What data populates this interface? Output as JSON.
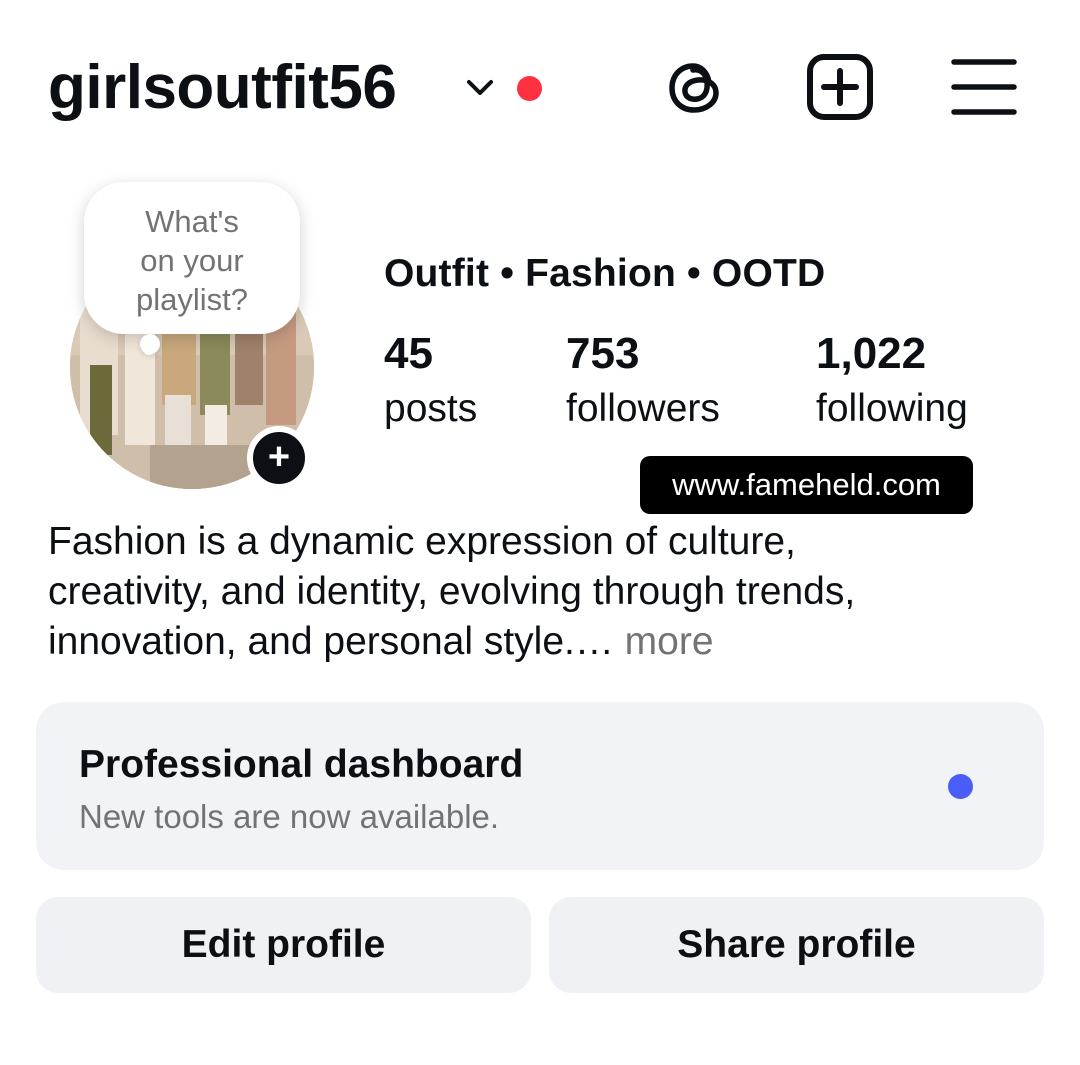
{
  "header": {
    "username": "girlsoutfit56",
    "icons": {
      "chevron": "chevron-down-icon",
      "notification_dot": "red-dot",
      "threads": "threads-icon",
      "create": "add-square-icon",
      "menu": "hamburger-menu-icon"
    },
    "notification_color": "#ff3040"
  },
  "profile": {
    "note_bubble": {
      "line1": "What's",
      "line2": "on your",
      "line3": "playlist?"
    },
    "add_story_label": "+",
    "category": "Outfit • Fashion • OOTD",
    "stats": [
      {
        "value": "45",
        "label": "posts"
      },
      {
        "value": "753",
        "label": "followers"
      },
      {
        "value": "1,022",
        "label": "following"
      }
    ],
    "watermark": "www.fameheld.com",
    "bio": {
      "line1": "Fashion is a dynamic expression of culture,",
      "line2": "creativity, and identity, evolving through trends,",
      "line3": "innovation, and personal style.…",
      "more": " more"
    }
  },
  "dashboard": {
    "title": "Professional dashboard",
    "subtitle": "New tools are now available.",
    "indicator_color": "#4a5df9"
  },
  "actions": {
    "edit_label": "Edit profile",
    "share_label": "Share profile"
  }
}
